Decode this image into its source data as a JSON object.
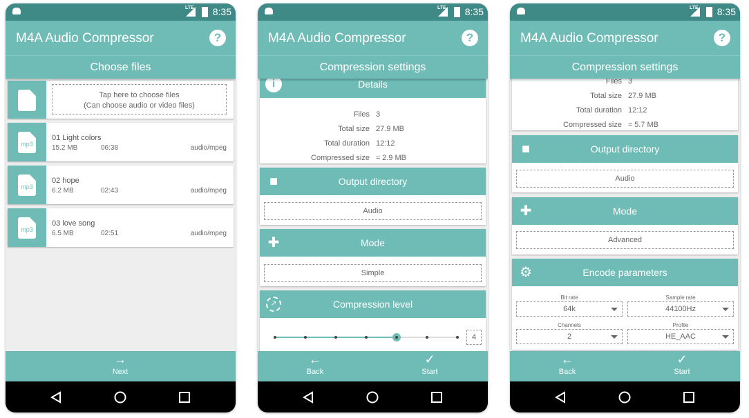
{
  "app": {
    "title": "M4A Audio Compressor",
    "help_icon": "?",
    "status_time": "8:35",
    "status_network": "LTE",
    "accent": "#6fbcb7",
    "status_bar_color": "#3f8a86"
  },
  "screen1": {
    "subtitle": "Choose files",
    "chooser": {
      "line1": "Tap here to choose files",
      "line2": "(Can choose audio or video files)"
    },
    "files": [
      {
        "icon": "mp3",
        "name": "01 Light colors",
        "size": "15.2 MB",
        "duration": "06:38",
        "type": "audio/mpeg"
      },
      {
        "icon": "mp3",
        "name": "02 hope",
        "size": "6.2 MB",
        "duration": "02:43",
        "type": "audio/mpeg"
      },
      {
        "icon": "mp3",
        "name": "03 love song",
        "size": "6.5 MB",
        "duration": "02:51",
        "type": "audio/mpeg"
      }
    ],
    "next_label": "Next"
  },
  "screen2": {
    "subtitle": "Compression settings",
    "details_title": "Details",
    "details": [
      {
        "k": "Files",
        "v": "3"
      },
      {
        "k": "Total size",
        "v": "27.9 MB"
      },
      {
        "k": "Total duration",
        "v": "12:12"
      },
      {
        "k": "Compressed size",
        "v": "≈ 2.9 MB"
      }
    ],
    "output_title": "Output directory",
    "output_value": "Audio",
    "mode_title": "Mode",
    "mode_value": "Simple",
    "level_title": "Compression level",
    "level_value": "4",
    "level_steps": 7,
    "level_index": 4,
    "back_label": "Back",
    "start_label": "Start"
  },
  "screen3": {
    "subtitle": "Compression settings",
    "details": [
      {
        "k": "Files",
        "v": "3"
      },
      {
        "k": "Total size",
        "v": "27.9 MB"
      },
      {
        "k": "Total duration",
        "v": "12:12"
      },
      {
        "k": "Compressed size",
        "v": "≈ 5.7 MB"
      }
    ],
    "output_title": "Output directory",
    "output_value": "Audio",
    "mode_title": "Mode",
    "mode_value": "Advanced",
    "encode_title": "Encode parameters",
    "params": [
      {
        "label": "Bit rate",
        "value": "64k"
      },
      {
        "label": "Sample rate",
        "value": "44100Hz"
      },
      {
        "label": "Channels",
        "value": "2"
      },
      {
        "label": "Profile",
        "value": "HE_AAC"
      }
    ],
    "back_label": "Back",
    "start_label": "Start"
  }
}
